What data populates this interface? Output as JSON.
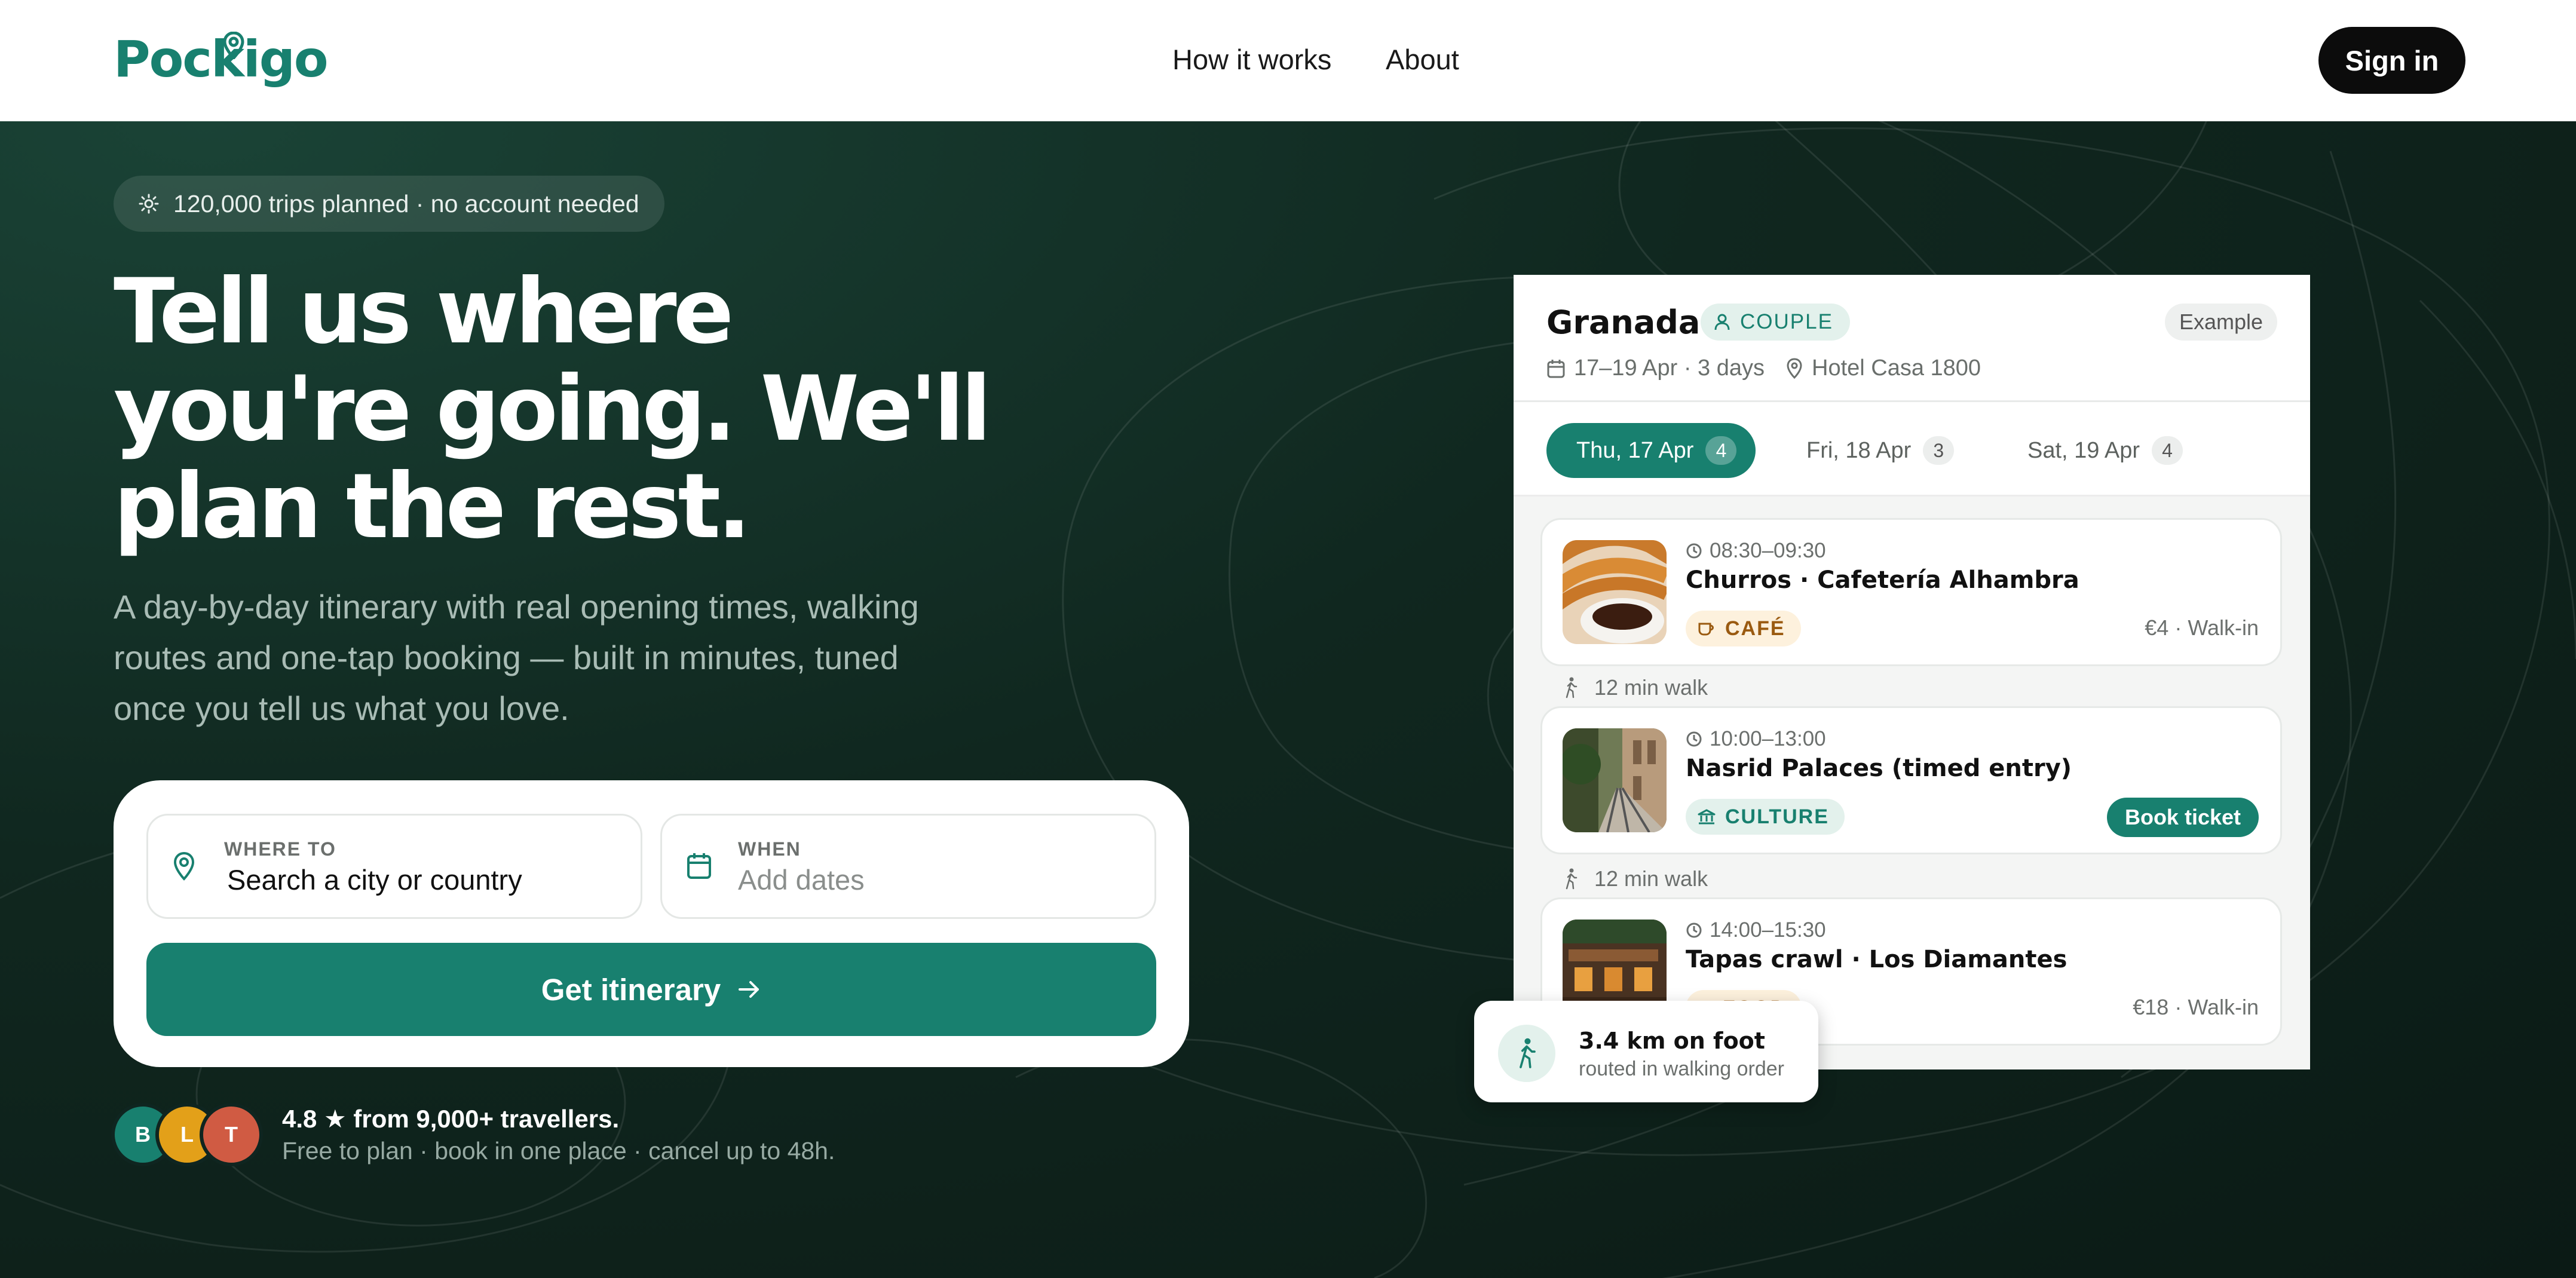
{
  "header": {
    "logo_text": "Pockigo",
    "nav": [
      "How it works",
      "About"
    ],
    "signin_label": "Sign in"
  },
  "hero": {
    "pill_text": "120,000 trips planned · no account needed",
    "headline_lines": [
      "Tell us where",
      "you're going. We'll",
      "plan the rest."
    ],
    "subtext_lines": [
      "A day-by-day itinerary with real opening times, walking",
      "routes and one-tap booking — built in minutes, tuned",
      "once you tell us what you love."
    ],
    "search": {
      "where_label": "WHERE TO",
      "where_value": "Search a city or country",
      "when_label": "WHEN",
      "when_placeholder": "Add dates",
      "button_label": "Get itinerary"
    },
    "social": {
      "avatars": [
        {
          "initial": "B",
          "color": "#18806f"
        },
        {
          "initial": "L",
          "color": "#e3a019"
        },
        {
          "initial": "T",
          "color": "#d05b43"
        }
      ],
      "rating_text": "4.8 ★ from 9,000+ travellers.",
      "rating_sub": "Free to plan · book in one place · cancel up to 48h."
    }
  },
  "itinerary": {
    "city": "Granada",
    "traveller_type": "COUPLE",
    "example_label": "Example",
    "dates": "17–19 Apr · 3 days",
    "hotel": "Hotel Casa 1800",
    "tabs": [
      {
        "label": "Thu, 17 Apr",
        "count": "4"
      },
      {
        "label": "Fri, 18 Apr",
        "count": "3"
      },
      {
        "label": "Sat, 19 Apr",
        "count": "4"
      }
    ],
    "activities": [
      {
        "time": "08:30–09:30",
        "title": "Churros · Cafetería Alhambra",
        "tag": "CAFÉ",
        "price": "€4 · Walk-in"
      },
      {
        "time": "10:00–13:00",
        "title": "Nasrid Palaces (timed entry)",
        "tag": "CULTURE",
        "action": "Book ticket"
      },
      {
        "time": "14:00–15:30",
        "title": "Tapas crawl · Los Diamantes",
        "tag": "FOOD",
        "price": "€18 · Walk-in"
      }
    ],
    "walks": [
      "12 min walk",
      "12 min walk"
    ],
    "foot": {
      "title": "3.4 km on foot",
      "subtitle": "routed in walking order"
    }
  },
  "colors": {
    "brand": "#18806f",
    "hero_bg": "#10271f",
    "dark_button": "#0c0c0c"
  }
}
